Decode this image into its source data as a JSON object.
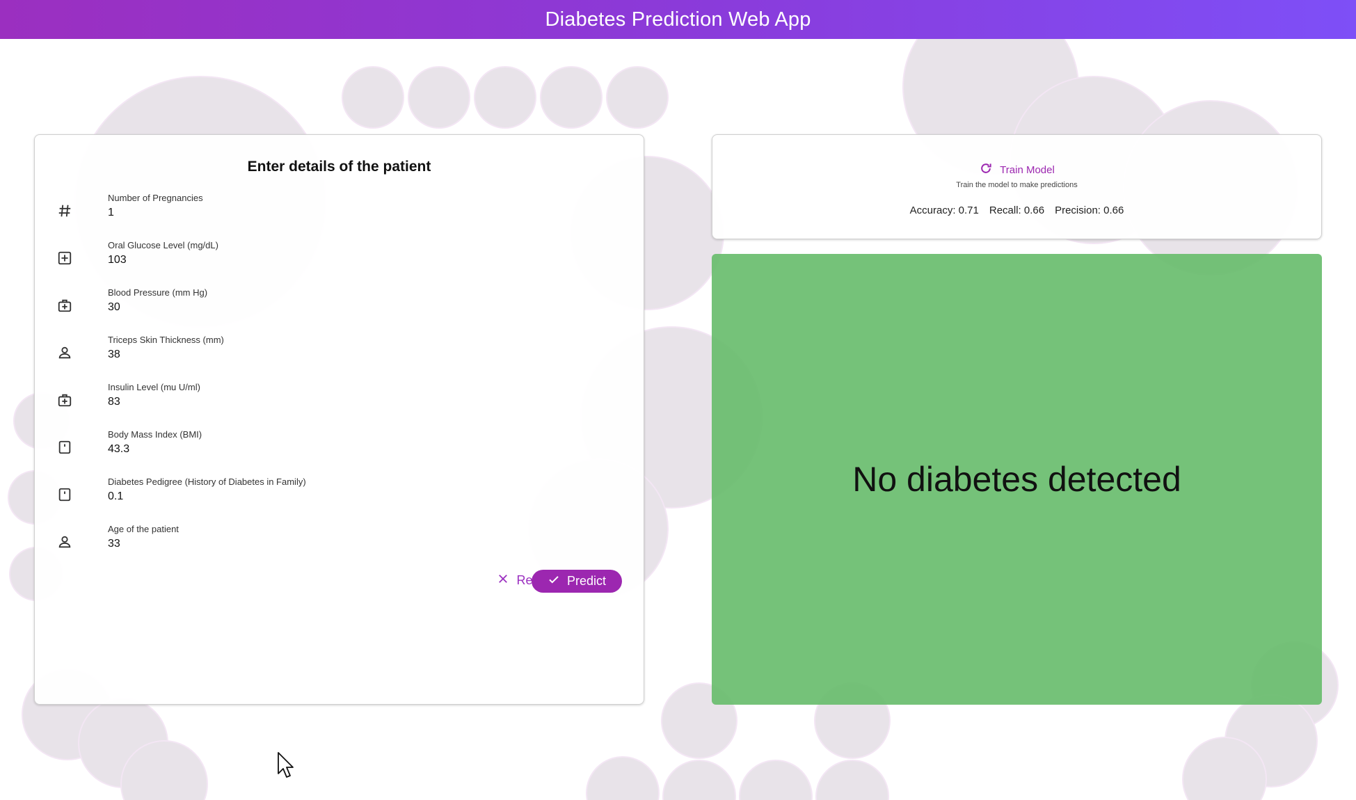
{
  "app": {
    "title": "Diabetes Prediction Web App"
  },
  "form": {
    "title": "Enter details of the patient",
    "fields": [
      {
        "label": "Number of Pregnancies",
        "value": "1",
        "icon": "hash-icon"
      },
      {
        "label": "Oral Glucose Level (mg/dL)",
        "value": "103",
        "icon": "plus-box-icon"
      },
      {
        "label": "Blood Pressure (mm Hg)",
        "value": "30",
        "icon": "medical-bag-icon"
      },
      {
        "label": "Triceps Skin Thickness (mm)",
        "value": "38",
        "icon": "person-icon"
      },
      {
        "label": "Insulin Level (mu U/ml)",
        "value": "83",
        "icon": "medical-bag-icon"
      },
      {
        "label": "Body Mass Index (BMI)",
        "value": "43.3",
        "icon": "scale-icon"
      },
      {
        "label": "Diabetes Pedigree (History of Diabetes in Family)",
        "value": "0.1",
        "icon": "scale-icon"
      },
      {
        "label": "Age of the patient",
        "value": "33",
        "icon": "person-icon"
      }
    ],
    "reset_label": "Reset",
    "predict_label": "Predict"
  },
  "training": {
    "button_label": "Train Model",
    "subtitle": "Train the model to make predictions",
    "accuracy": "Accuracy: 0.71",
    "recall": "Recall: 0.66",
    "precision": "Precision: 0.66"
  },
  "result": {
    "text": "No diabetes detected"
  },
  "colors": {
    "accent": "#9c27b0",
    "appbar_start": "#9b2fc0",
    "appbar_end": "#7e4ff7",
    "result_bg": "#66bb6a",
    "bubble": "#e9e4ea"
  }
}
